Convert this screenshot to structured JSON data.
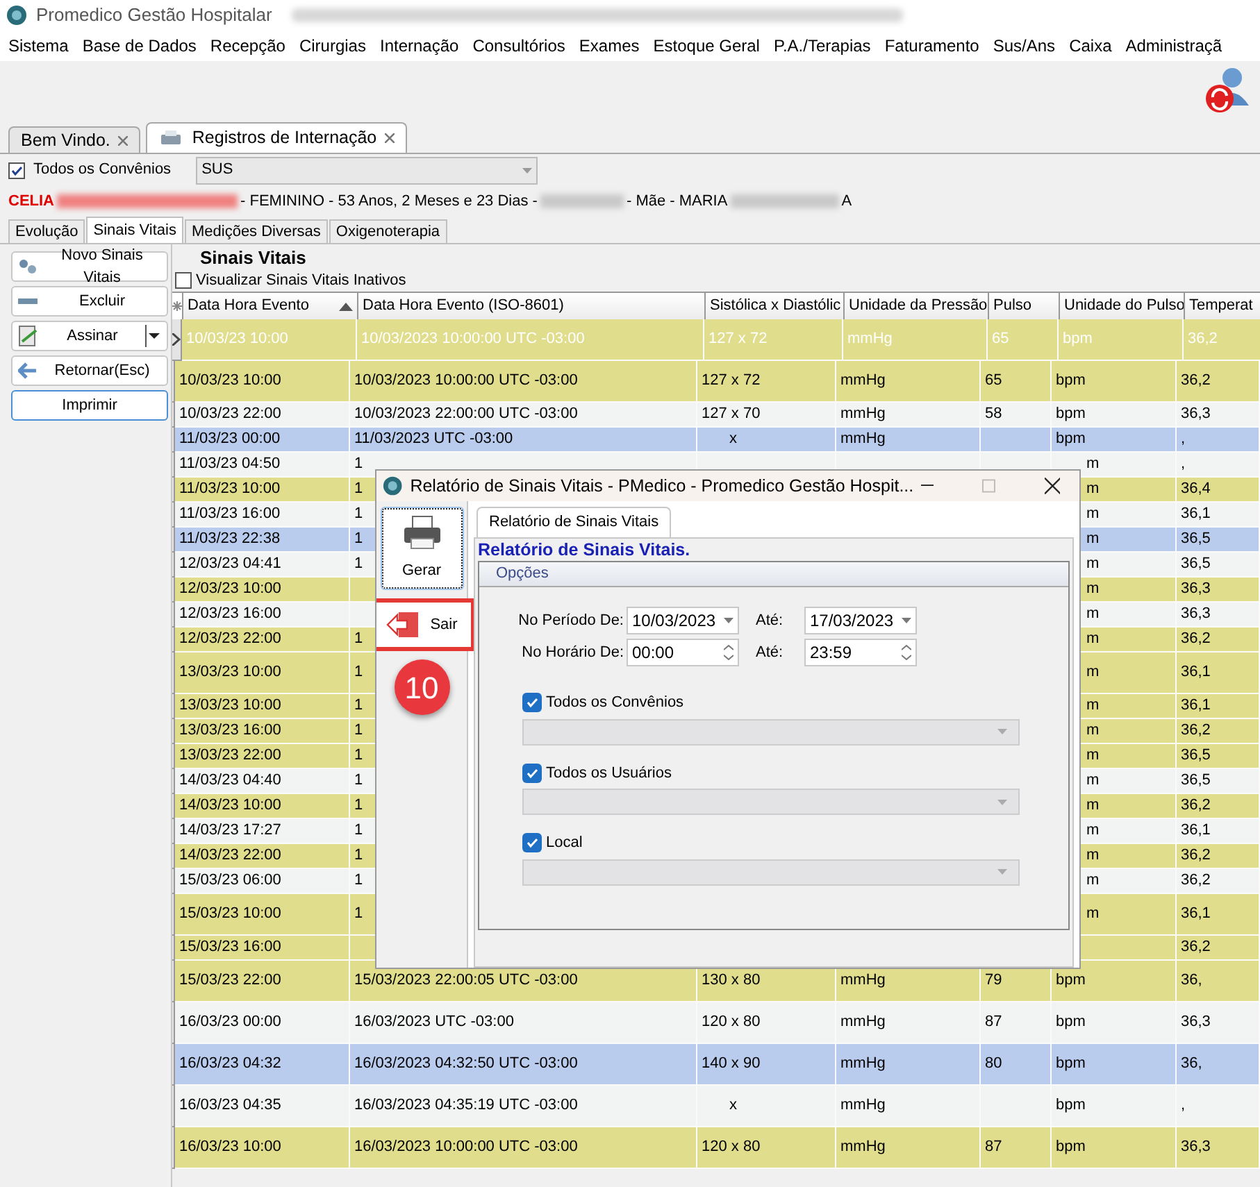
{
  "window": {
    "title": "Promedico Gestão Hospitalar"
  },
  "menu": [
    "Sistema",
    "Base de Dados",
    "Recepção",
    "Cirurgias",
    "Internação",
    "Consultórios",
    "Exames",
    "Estoque Geral",
    "P.A./Terapias",
    "Faturamento",
    "Sus/Ans",
    "Caixa",
    "Administraçã"
  ],
  "doc_tabs": [
    {
      "label": "Bem Vindo.",
      "selected": false
    },
    {
      "label": "Registros de Internação",
      "selected": true
    }
  ],
  "filter": {
    "label": "Todos os Convênios",
    "checked": true,
    "value": "SUS"
  },
  "patient": {
    "name": "CELIA",
    "details": "- FEMININO - 53 Anos, 2 Meses e 23 Dias -",
    "mother": "- Mãe - MARIA",
    "mother_end": "A"
  },
  "sub_tabs": [
    {
      "label": "Evolução",
      "selected": false
    },
    {
      "label": "Sinais Vitais",
      "selected": true
    },
    {
      "label": "Medições Diversas",
      "selected": false
    },
    {
      "label": "Oxigenoterapia",
      "selected": false
    }
  ],
  "actions": [
    {
      "label": "Novo Sinais Vitais",
      "kind": "gears"
    },
    {
      "label": "Excluir",
      "kind": "minus"
    },
    {
      "label": "Assinar",
      "kind": "sign"
    },
    {
      "label": "Retornar(Esc)",
      "kind": "back"
    },
    {
      "label": "Imprimir",
      "kind": "plain"
    }
  ],
  "section_title": "Sinais Vitais",
  "inactive_toggle": {
    "label": "Visualizar Sinais Vitais Inativos",
    "checked": false
  },
  "table": {
    "columns": [
      "Data Hora Evento",
      "Data Hora Evento (ISO-8601)",
      "Sistólica x Diastólic",
      "Unidade da Pressão",
      "Pulso",
      "Unidade do Pulso",
      "Temperat"
    ],
    "rows": [
      {
        "cells": [
          "10/03/23 10:00",
          "10/03/2023 10:00:00 UTC -03:00",
          "127 x 72",
          "mmHg",
          "65",
          "bpm",
          "36,2"
        ],
        "color": "#e0dd8c",
        "tall": true,
        "current": true
      },
      {
        "cells": [
          "10/03/23 10:00",
          "10/03/2023 10:00:00 UTC -03:00",
          "127 x 72",
          "mmHg",
          "65",
          "bpm",
          "36,2"
        ],
        "color": "#e0dd8c",
        "tall": true,
        "current": false
      },
      {
        "cells": [
          "10/03/23 22:00",
          "10/03/2023 22:00:00 UTC -03:00",
          "127 x 70",
          "mmHg",
          "58",
          "bpm",
          "36,3"
        ],
        "color": "#f2f3f3",
        "tall": false,
        "current": false
      },
      {
        "cells": [
          "11/03/23 00:00",
          "11/03/2023 UTC -03:00",
          "x",
          "mmHg",
          null,
          "bpm",
          ","
        ],
        "color": "#b9cced",
        "tall": false,
        "current": false
      },
      {
        "cells": [
          "11/03/23 04:50",
          "1",
          null,
          null,
          null,
          "m",
          ","
        ],
        "color": "#f2f3f3",
        "tall": false,
        "current": false
      },
      {
        "cells": [
          "11/03/23 10:00",
          "1",
          null,
          null,
          null,
          "m",
          "36,4"
        ],
        "color": "#e0dd8c",
        "tall": false,
        "current": false
      },
      {
        "cells": [
          "11/03/23 16:00",
          "1",
          null,
          null,
          null,
          "m",
          "36,1"
        ],
        "color": "#f2f3f3",
        "tall": false,
        "current": false
      },
      {
        "cells": [
          "11/03/23 22:38",
          "1",
          null,
          null,
          null,
          "m",
          "36,5"
        ],
        "color": "#b9cced",
        "tall": false,
        "current": false
      },
      {
        "cells": [
          "12/03/23 04:41",
          "1",
          null,
          null,
          null,
          "m",
          "36,5"
        ],
        "color": "#f2f3f3",
        "tall": false,
        "current": false
      },
      {
        "cells": [
          "12/03/23 10:00",
          null,
          null,
          null,
          null,
          "m",
          "36,3"
        ],
        "color": "#e0dd8c",
        "tall": false,
        "current": false
      },
      {
        "cells": [
          "12/03/23 16:00",
          null,
          null,
          null,
          null,
          "m",
          "36,3"
        ],
        "color": "#f2f3f3",
        "tall": false,
        "current": false
      },
      {
        "cells": [
          "12/03/23 22:00",
          "1",
          null,
          null,
          null,
          "m",
          "36,2"
        ],
        "color": "#e0dd8c",
        "tall": false,
        "current": false
      },
      {
        "cells": [
          "13/03/23 10:00",
          "1",
          null,
          null,
          null,
          "m",
          "36,1"
        ],
        "color": "#e0dd8c",
        "tall": true,
        "current": false
      },
      {
        "cells": [
          "13/03/23 10:00",
          "1",
          null,
          null,
          null,
          "m",
          "36,1"
        ],
        "color": "#e0dd8c",
        "tall": false,
        "current": false
      },
      {
        "cells": [
          "13/03/23 16:00",
          "1",
          null,
          null,
          null,
          "m",
          "36,2"
        ],
        "color": "#e0dd8c",
        "tall": false,
        "current": false
      },
      {
        "cells": [
          "13/03/23 22:00",
          "1",
          null,
          null,
          null,
          "m",
          "36,5"
        ],
        "color": "#e0dd8c",
        "tall": false,
        "current": false
      },
      {
        "cells": [
          "14/03/23 04:40",
          "1",
          null,
          null,
          null,
          "m",
          "36,5"
        ],
        "color": "#f2f3f3",
        "tall": false,
        "current": false
      },
      {
        "cells": [
          "14/03/23 10:00",
          "1",
          null,
          null,
          null,
          "m",
          "36,2"
        ],
        "color": "#e0dd8c",
        "tall": false,
        "current": false
      },
      {
        "cells": [
          "14/03/23 17:27",
          "1",
          null,
          null,
          null,
          "m",
          "36,1"
        ],
        "color": "#f2f3f3",
        "tall": false,
        "current": false
      },
      {
        "cells": [
          "14/03/23 22:00",
          "1",
          null,
          null,
          null,
          "m",
          "36,2"
        ],
        "color": "#e0dd8c",
        "tall": false,
        "current": false
      },
      {
        "cells": [
          "15/03/23 06:00",
          "1",
          null,
          null,
          null,
          "m",
          "36,2"
        ],
        "color": "#f2f3f3",
        "tall": false,
        "current": false
      },
      {
        "cells": [
          "15/03/23 10:00",
          "1",
          null,
          null,
          null,
          "m",
          "36,1"
        ],
        "color": "#e0dd8c",
        "tall": true,
        "current": false
      },
      {
        "cells": [
          "15/03/23 16:00",
          null,
          null,
          null,
          null,
          null,
          "36,2"
        ],
        "color": "#e0dd8c",
        "tall": false,
        "current": false
      },
      {
        "cells": [
          "15/03/23 22:00",
          "15/03/2023 22:00:05 UTC -03:00",
          "130 x 80",
          "mmHg",
          "79",
          "bpm",
          "36,"
        ],
        "color": "#e0dd8c",
        "tall": true,
        "current": false
      },
      {
        "cells": [
          "16/03/23 00:00",
          "16/03/2023 UTC -03:00",
          "120 x 80",
          "mmHg",
          "87",
          "bpm",
          "36,3"
        ],
        "color": "#f2f3f3",
        "tall": true,
        "current": false
      },
      {
        "cells": [
          "16/03/23 04:32",
          "16/03/2023 04:32:50 UTC -03:00",
          "140 x 90",
          "mmHg",
          "80",
          "bpm",
          "36,"
        ],
        "color": "#b9cced",
        "tall": true,
        "current": false
      },
      {
        "cells": [
          "16/03/23 04:35",
          "16/03/2023 04:35:19 UTC -03:00",
          "x",
          "mmHg",
          null,
          "bpm",
          ","
        ],
        "color": "#f2f3f3",
        "tall": true,
        "current": false
      },
      {
        "cells": [
          "16/03/23 10:00",
          "16/03/2023 10:00:00 UTC -03:00",
          "120 x 80",
          "mmHg",
          "87",
          "bpm",
          "36,3"
        ],
        "color": "#e0dd8c",
        "tall": true,
        "current": false
      }
    ]
  },
  "dialog": {
    "title": "Relatório de Sinais Vitais - PMedico - Promedico Gestão Hospit...",
    "buttons": [
      {
        "label": "Gerar",
        "kind": "print",
        "focused": true,
        "highlighted": false
      },
      {
        "label": "Sair",
        "kind": "exit",
        "focused": false,
        "highlighted": true
      }
    ],
    "callout": "10",
    "tab": "Relatório de Sinais Vitais",
    "heading": "Relatório de Sinais Vitais.",
    "group": "Opções",
    "period": {
      "label": "No Período De:",
      "from": "10/03/2023",
      "to_label": "Até:",
      "to": "17/03/2023"
    },
    "hours": {
      "label": "No Horário De:",
      "from": "00:00",
      "to_label": "Até:",
      "to": "23:59"
    },
    "filters": [
      {
        "label": "Todos os Convênios",
        "checked": true
      },
      {
        "label": "Todos os Usuários",
        "checked": true
      },
      {
        "label": "Local",
        "checked": true
      }
    ]
  }
}
